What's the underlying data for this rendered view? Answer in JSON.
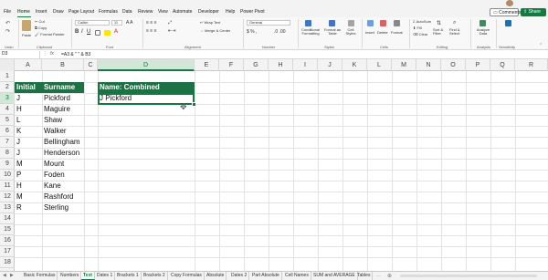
{
  "menu": {
    "tabs": [
      "File",
      "Home",
      "Insert",
      "Draw",
      "Page Layout",
      "Formulas",
      "Data",
      "Review",
      "View",
      "Automate",
      "Developer",
      "Help",
      "Power Pivot"
    ],
    "active": "Home",
    "comments_label": "Comments",
    "share_label": "Share"
  },
  "ribbon": {
    "undo_group": "Undo",
    "clipboard": {
      "paste": "Paste",
      "cut": "Cut",
      "copy": "Copy",
      "format_painter": "Format Painter",
      "label": "Clipboard"
    },
    "font": {
      "name": "Calibri",
      "size": "11",
      "label": "Font"
    },
    "alignment": {
      "wrap": "Wrap Text",
      "merge": "Merge & Center",
      "label": "Alignment"
    },
    "number": {
      "format": "General",
      "label": "Number"
    },
    "styles": {
      "conditional": "Conditional Formatting",
      "format_table": "Format as Table",
      "cell_styles": "Cell Styles",
      "label": "Styles"
    },
    "cells": {
      "insert": "Insert",
      "delete": "Delete",
      "format": "Format",
      "label": "Cells"
    },
    "editing": {
      "autosum": "AutoSum",
      "fill": "Fill",
      "clear": "Clear",
      "sort": "Sort & Filter",
      "find": "Find & Select",
      "label": "Editing"
    },
    "analysis": {
      "analyze": "Analyze Data",
      "label": "Analysis"
    },
    "sensitivity": {
      "label": "Sensitivity"
    }
  },
  "formula_bar": {
    "name_box": "D3",
    "fx": "fx",
    "formula": "=A3 & \" \" & B3"
  },
  "grid": {
    "columns": [
      "A",
      "B",
      "C",
      "D",
      "E",
      "F",
      "G",
      "H",
      "I",
      "J",
      "K",
      "L",
      "M",
      "N",
      "O",
      "P",
      "Q",
      "R"
    ],
    "selected_column": "D",
    "rows": [
      "1",
      "2",
      "3",
      "4",
      "5",
      "6",
      "7",
      "8",
      "9",
      "10",
      "11",
      "12",
      "13",
      "14",
      "15",
      "16",
      "17",
      "18"
    ],
    "selected_row": "3",
    "header_initial": "Initial",
    "header_surname": "Surname",
    "header_combined": "Name: Combined",
    "data": [
      [
        "J",
        "Pickford"
      ],
      [
        "H",
        "Maguire"
      ],
      [
        "L",
        "Shaw"
      ],
      [
        "K",
        "Walker"
      ],
      [
        "J",
        "Bellingham"
      ],
      [
        "J",
        "Henderson"
      ],
      [
        "M",
        "Mount"
      ],
      [
        "P",
        "Foden"
      ],
      [
        "H",
        "Kane"
      ],
      [
        "M",
        "Rashford"
      ],
      [
        "R",
        "Sterling"
      ]
    ],
    "combined": "J Pickford"
  },
  "sheet_tabs": {
    "tabs": [
      "Basic Formulas",
      "Numbers",
      "Text",
      "Dates 1",
      "Brackets 1",
      "Brackets 2",
      "Copy Formulas",
      "Absolute",
      "Dates 2",
      "Part Absolute",
      "Cell Names",
      "SUM and AVERAGE",
      "Tables"
    ],
    "active": "Text"
  }
}
